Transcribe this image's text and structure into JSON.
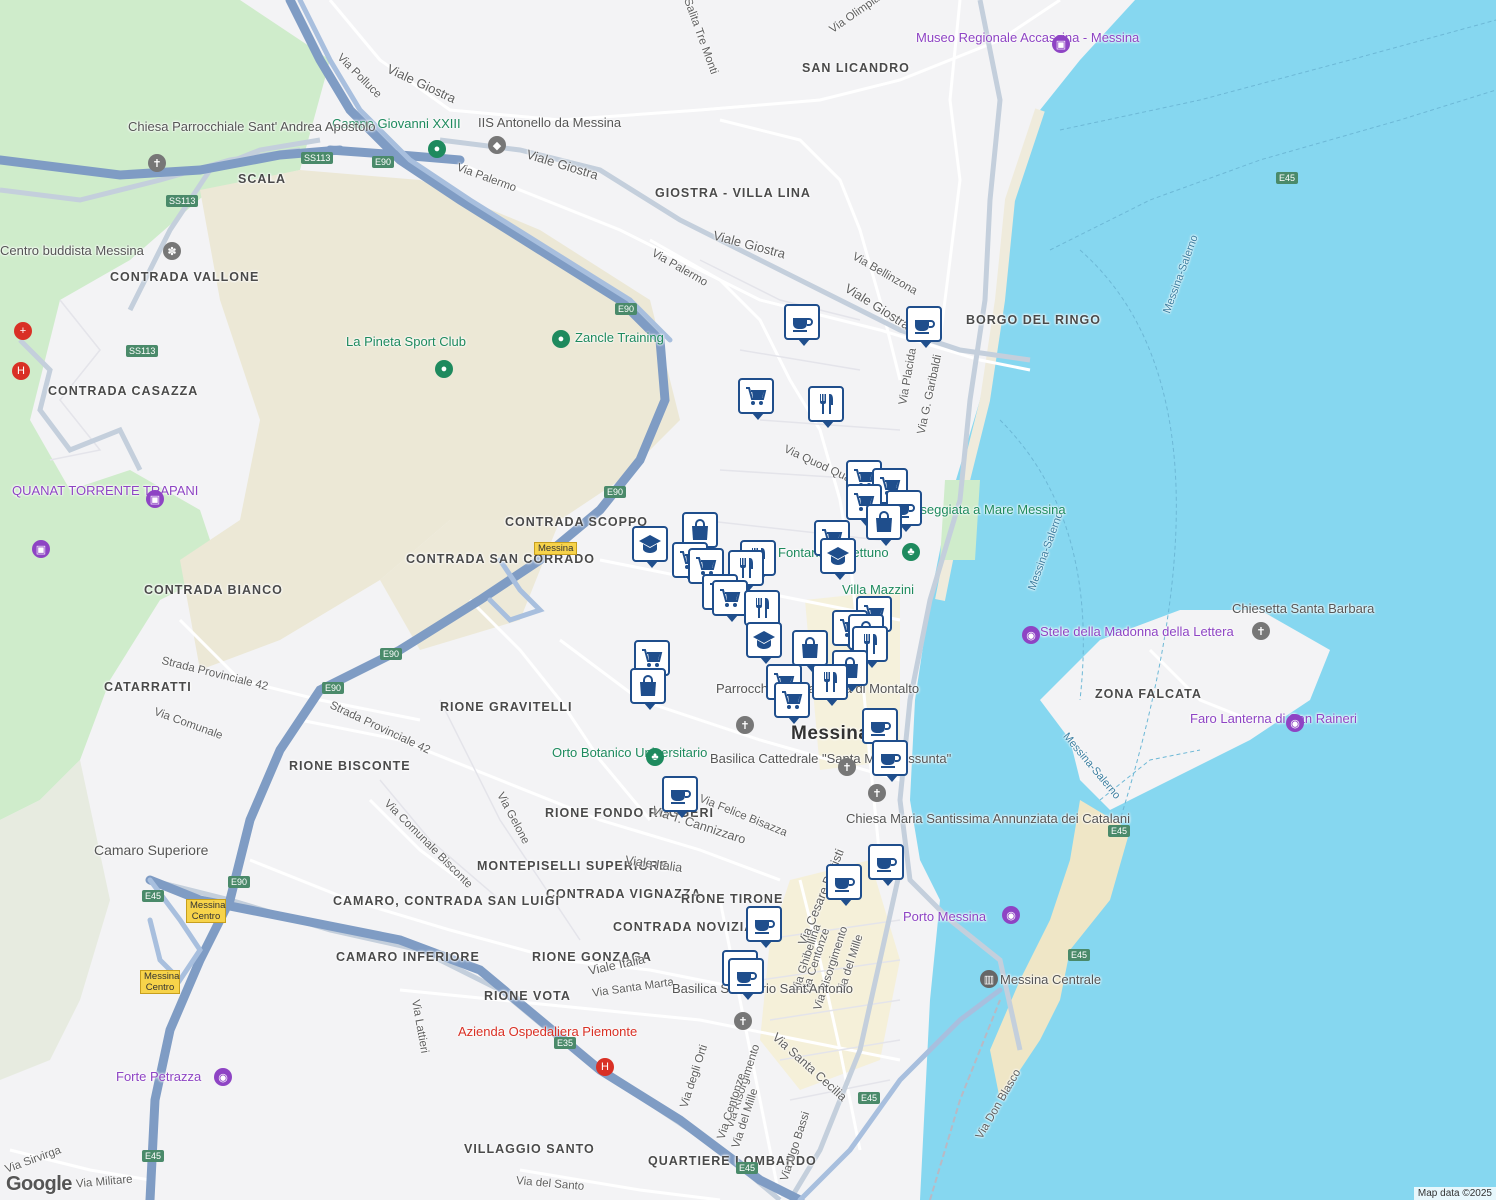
{
  "map": {
    "attribution": "Map data ©2025",
    "provider": "Google",
    "city_label": "Messina",
    "colors": {
      "sea": "#86d7f0",
      "land": "#f3f3f5",
      "park": "#cfeccb",
      "sand": "#efebdc",
      "road": "#ffffff",
      "highway": "#8fa8cc",
      "pin_border": "#1f4e8c"
    },
    "areas": [
      "SAN LICANDRO",
      "GIOSTRA - VILLA LINA",
      "BORGO DEL RINGO",
      "SCALA",
      "CONTRADA VALLONE",
      "CONTRADA CASAZZA",
      "CONTRADA SCOPPO",
      "CONTRADA SAN CORRADO",
      "CONTRADA BIANCO",
      "CATARRATTI",
      "RIONE GRAVITELLI",
      "RIONE BISCONTE",
      "RIONE FONDO RUGGERI",
      "MONTEPISELLI SUPERIORE",
      "CONTRADA VIGNAZZA",
      "RIONE TIRONE",
      "CONTRADA NOVIZIATO",
      "CAMARO, CONTRADA SAN LUIGI",
      "CAMARO INFERIORE",
      "RIONE GONZAGA",
      "RIONE VOTA",
      "Camaro Superiore",
      "VILLAGGIO SANTO",
      "QUARTIERE LOMBARDO",
      "ZONA FALCATA"
    ],
    "streets": [
      "Via Olimpia",
      "Salita Tre Monti",
      "Viale Giostra",
      "Via Palermo",
      "Via Polluce",
      "Via Bellinzona",
      "Via Placida",
      "Via G. Garibaldi",
      "Via Quod Quaeris",
      "Strada Provinciale 42",
      "Via Comunale",
      "Via Gelone",
      "Via Comunale Bisconte",
      "Viale Italia",
      "Via T. Cannizzaro",
      "Via Felice Bisazza",
      "Via Cesare Battisti",
      "Via Ghibellina",
      "Via Centonze",
      "Via Risorgimento",
      "Via del Mille",
      "Via Santa Marta",
      "Via Santa Cecilia",
      "Via degli Orti",
      "Via Ugo Bassi",
      "Via Don Blasco",
      "Via Lattieri",
      "Via del Santo",
      "Via Militare",
      "Via Sirvirga",
      "Messina-Salerno"
    ],
    "pois": [
      "Museo Regionale Accascina - Messina",
      "Campo Giovanni XXIII",
      "IIS Antonello da Messina",
      "Chiesa Parrocchiale Sant' Andrea Apostolo",
      "Centro buddista Messina",
      "La Pineta Sport Club",
      "Zancle Training",
      "QUANAT TORRENTE TRAPANI",
      "Passeggiata a Mare Messina",
      "Fontana di Nettuno",
      "Villa Mazzini",
      "Orto Botanico Universitario",
      "Basilica Cattedrale \"Santa Maria Assunta\"",
      "Chiesa Maria Santissima Annunziata dei Catalani",
      "Porto Messina",
      "Messina Centrale",
      "Basilica Santuario Sant'Antonio",
      "Azienda Ospedaliera Piemonte",
      "Forte Petrazza",
      "Stele della Madonna della Lettera",
      "Chiesetta Santa Barbara",
      "Faro Lanterna di San Raineri",
      "Parrocchia Santa Maria di Montalto"
    ],
    "road_shields": [
      "SS113",
      "E90",
      "E45",
      "E35"
    ],
    "exits": [
      "Messina",
      "Messina Centro"
    ]
  }
}
